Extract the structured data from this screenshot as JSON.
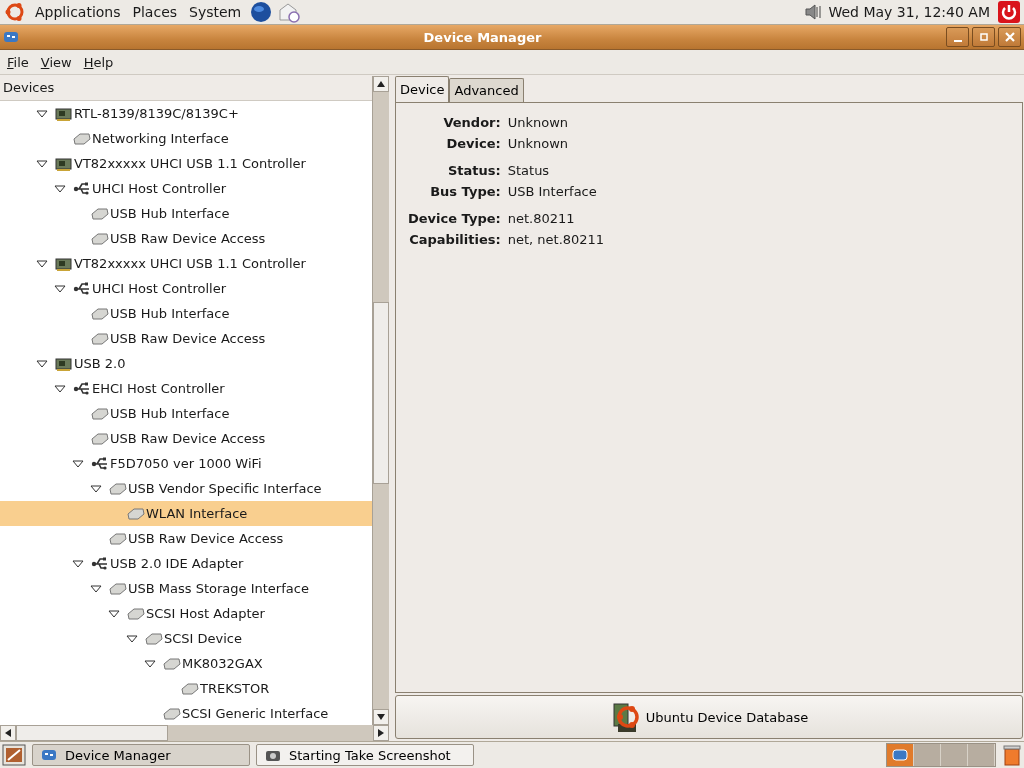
{
  "top_panel": {
    "menus": [
      "Applications",
      "Places",
      "System"
    ],
    "clock": "Wed May 31, 12:40 AM"
  },
  "window": {
    "title": "Device Manager"
  },
  "menubar": [
    {
      "label": "File"
    },
    {
      "label": "View"
    },
    {
      "label": "Help"
    }
  ],
  "tree": {
    "header": "Devices",
    "items": [
      {
        "label": "RTL-8139/8139C/8139C+",
        "kind": "card",
        "expanded": true,
        "selected": false,
        "children": [
          {
            "label": "Networking Interface",
            "kind": "chip",
            "selected": false
          }
        ]
      },
      {
        "label": "VT82xxxxx UHCI USB 1.1 Controller",
        "kind": "card",
        "expanded": true,
        "selected": false,
        "children": [
          {
            "label": "UHCI Host Controller",
            "kind": "usb",
            "expanded": true,
            "selected": false,
            "children": [
              {
                "label": "USB Hub Interface",
                "kind": "chip",
                "selected": false
              },
              {
                "label": "USB Raw Device Access",
                "kind": "chip",
                "selected": false
              }
            ]
          }
        ]
      },
      {
        "label": "VT82xxxxx UHCI USB 1.1 Controller",
        "kind": "card",
        "expanded": true,
        "selected": false,
        "children": [
          {
            "label": "UHCI Host Controller",
            "kind": "usb",
            "expanded": true,
            "selected": false,
            "children": [
              {
                "label": "USB Hub Interface",
                "kind": "chip",
                "selected": false
              },
              {
                "label": "USB Raw Device Access",
                "kind": "chip",
                "selected": false
              }
            ]
          }
        ]
      },
      {
        "label": "USB 2.0",
        "kind": "card",
        "expanded": true,
        "selected": false,
        "children": [
          {
            "label": "EHCI Host Controller",
            "kind": "usb",
            "expanded": true,
            "selected": false,
            "children": [
              {
                "label": "USB Hub Interface",
                "kind": "chip",
                "selected": false
              },
              {
                "label": "USB Raw Device Access",
                "kind": "chip",
                "selected": false
              },
              {
                "label": "F5D7050 ver 1000 WiFi",
                "kind": "usb",
                "expanded": true,
                "selected": false,
                "children": [
                  {
                    "label": "USB Vendor Specific Interface",
                    "kind": "chip",
                    "expanded": true,
                    "selected": false,
                    "children": [
                      {
                        "label": "WLAN Interface",
                        "kind": "chip",
                        "selected": true
                      }
                    ]
                  },
                  {
                    "label": "USB Raw Device Access",
                    "kind": "chip",
                    "selected": false
                  }
                ]
              },
              {
                "label": "USB 2.0 IDE Adapter",
                "kind": "usb",
                "expanded": true,
                "selected": false,
                "children": [
                  {
                    "label": "USB Mass Storage Interface",
                    "kind": "chip",
                    "expanded": true,
                    "selected": false,
                    "children": [
                      {
                        "label": "SCSI Host Adapter",
                        "kind": "chip",
                        "expanded": true,
                        "selected": false,
                        "children": [
                          {
                            "label": "SCSI Device",
                            "kind": "chip",
                            "expanded": true,
                            "selected": false,
                            "children": [
                              {
                                "label": "MK8032GAX",
                                "kind": "chip",
                                "expanded": true,
                                "selected": false,
                                "children": [
                                  {
                                    "label": "TREKSTOR",
                                    "kind": "chip",
                                    "selected": false
                                  }
                                ]
                              },
                              {
                                "label": "SCSI Generic Interface",
                                "kind": "chip",
                                "selected": false
                              }
                            ]
                          }
                        ]
                      }
                    ]
                  }
                ]
              }
            ]
          }
        ]
      }
    ]
  },
  "tabs": [
    {
      "label": "Device",
      "selected": true
    },
    {
      "label": "Advanced",
      "selected": false
    }
  ],
  "properties": [
    {
      "label": "Vendor:",
      "value": "Unknown"
    },
    {
      "label": "Device:",
      "value": "Unknown"
    },
    {
      "label": "Status:",
      "value": "Status"
    },
    {
      "label": "Bus Type:",
      "value": "USB Interface"
    },
    {
      "label": "Device Type:",
      "value": "net.80211"
    },
    {
      "label": "Capabilities:",
      "value": "net, net.80211"
    }
  ],
  "database_button": "Ubuntu Device Database",
  "taskbar": [
    {
      "label": "Device Manager",
      "kind": "app",
      "selected": true
    },
    {
      "label": "Starting Take Screenshot",
      "kind": "camera",
      "selected": false
    }
  ]
}
